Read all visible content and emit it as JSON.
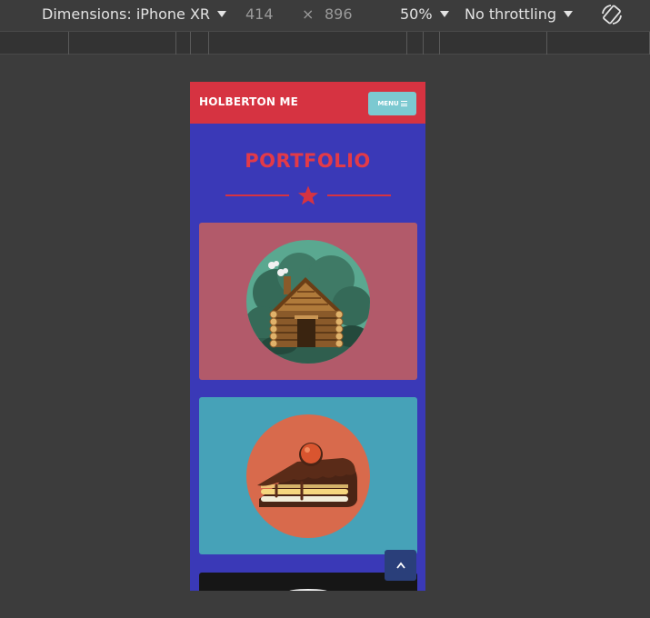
{
  "devtools": {
    "dimensions_label": "Dimensions: iPhone XR",
    "width": "414",
    "times": "×",
    "height": "896",
    "zoom": "50%",
    "throttling": "No throttling",
    "rotate_icon": "rotate-device-icon"
  },
  "site": {
    "brand": "HOLBERTON ME",
    "menu_label": "MENU",
    "menu_icon": "hamburger-icon",
    "portfolio_title": "PORTFOLIO",
    "divider_icon": "star-icon",
    "cards": [
      {
        "icon": "log-cabin-icon",
        "color": "#b25a6a"
      },
      {
        "icon": "cake-slice-icon",
        "color": "#46a2b8"
      },
      {
        "icon": "unknown-icon",
        "color": "#161616"
      }
    ],
    "scroll_top_icon": "chevron-up-icon"
  },
  "colors": {
    "navbar": "#d63341",
    "page_bg": "#3a39b7",
    "menu_button": "#7cc9d1",
    "accent": "#e23a48"
  }
}
